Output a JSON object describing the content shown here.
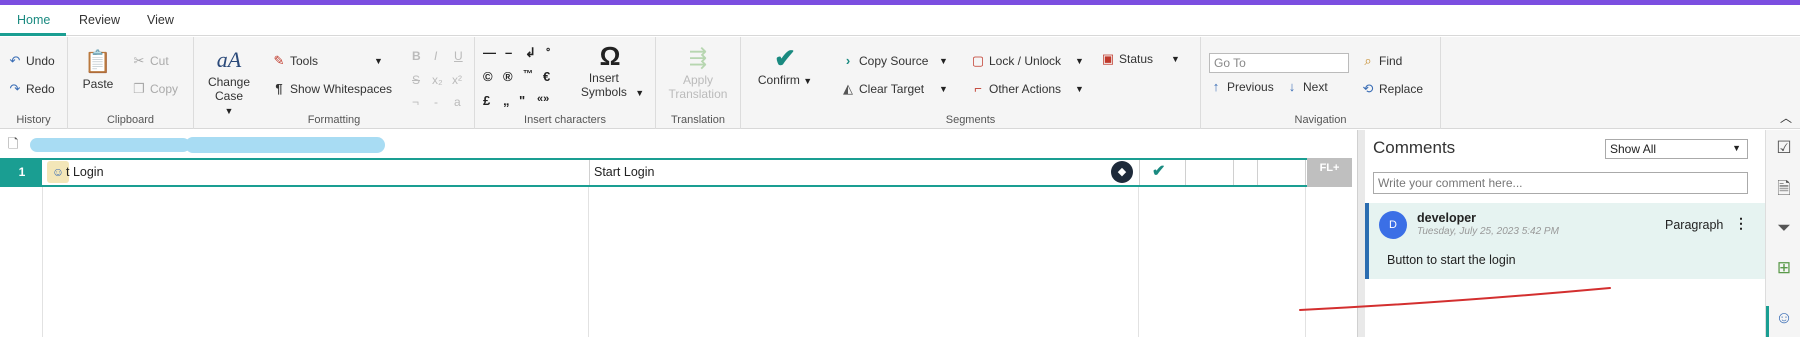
{
  "tabs": [
    {
      "label": "Home",
      "active": true
    },
    {
      "label": "Review",
      "active": false
    },
    {
      "label": "View",
      "active": false
    }
  ],
  "ribbon": {
    "history": {
      "label": "History",
      "undo": "Undo",
      "redo": "Redo"
    },
    "clipboard": {
      "label": "Clipboard",
      "paste": "Paste",
      "cut": "Cut",
      "copy": "Copy"
    },
    "formatting": {
      "label": "Formatting",
      "change_case": "Change Case",
      "tools": "Tools",
      "show_whitespaces": "Show Whitespaces"
    },
    "insert_characters": {
      "label": "Insert characters",
      "insert_symbols": "Insert Symbols",
      "symbols": [
        "©",
        "®",
        "™",
        "€",
        "£",
        "„",
        "\"",
        "«»"
      ]
    },
    "translation": {
      "label": "Translation",
      "apply_translation": "Apply Translation"
    },
    "segments": {
      "label": "Segments",
      "confirm": "Confirm",
      "copy_source": "Copy Source",
      "clear_target": "Clear Target",
      "lock_unlock": "Lock / Unlock",
      "other_actions": "Other Actions",
      "status": "Status"
    },
    "navigation": {
      "label": "Navigation",
      "goto_placeholder": "Go To",
      "previous": "Previous",
      "next": "Next",
      "find": "Find",
      "replace": "Replace"
    }
  },
  "editor": {
    "segment": {
      "number": "1",
      "source": "t Login",
      "target": "Start Login",
      "badge": "FL+"
    }
  },
  "comments": {
    "title": "Comments",
    "filter": "Show All",
    "input_placeholder": "Write your comment here...",
    "items": [
      {
        "initial": "D",
        "author": "developer",
        "date": "Tuesday, July 25, 2023 5:42 PM",
        "type": "Paragraph",
        "body": "Button to start the login"
      }
    ]
  },
  "colors": {
    "accent": "#1a9e92",
    "topbar": "#7b4ee0",
    "avatar": "#3b6fe6",
    "annotation": "#d32f2f"
  }
}
